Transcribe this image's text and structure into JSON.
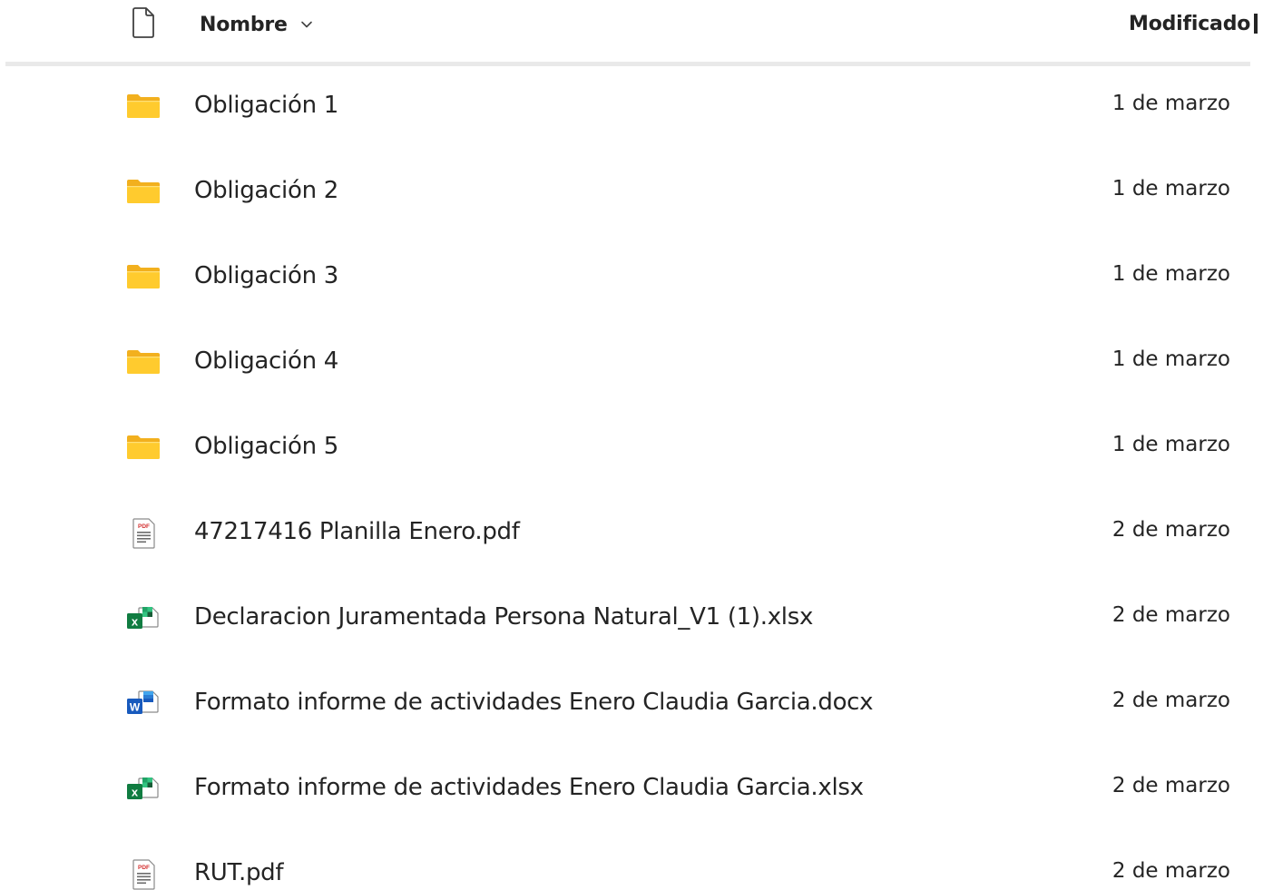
{
  "header": {
    "name_label": "Nombre",
    "modified_label": "Modificado",
    "file_icon": "file-icon",
    "sort_icon": "chevron-down-icon"
  },
  "colors": {
    "folder_front": "#FFCB2E",
    "folder_back": "#F2B01E",
    "excel_green": "#107C41",
    "word_blue": "#185ABD",
    "pdf_red": "#D32F2F",
    "divider": "#E9E9E9"
  },
  "items": [
    {
      "type": "folder",
      "icon": "folder-icon",
      "name": "Obligación 1",
      "modified": "1 de marzo"
    },
    {
      "type": "folder",
      "icon": "folder-icon",
      "name": "Obligación 2",
      "modified": "1 de marzo"
    },
    {
      "type": "folder",
      "icon": "folder-icon",
      "name": "Obligación 3",
      "modified": "1 de marzo"
    },
    {
      "type": "folder",
      "icon": "folder-icon",
      "name": "Obligación 4",
      "modified": "1 de marzo"
    },
    {
      "type": "folder",
      "icon": "folder-icon",
      "name": "Obligación 5",
      "modified": "1 de marzo"
    },
    {
      "type": "pdf",
      "icon": "pdf-file-icon",
      "name": "47217416 Planilla Enero.pdf",
      "modified": "2 de marzo"
    },
    {
      "type": "excel",
      "icon": "excel-file-icon",
      "name": "Declaracion Juramentada Persona Natural_V1 (1).xlsx",
      "modified": "2 de marzo"
    },
    {
      "type": "word",
      "icon": "word-file-icon",
      "name": "Formato informe de actividades Enero Claudia Garcia.docx",
      "modified": "2 de marzo"
    },
    {
      "type": "excel",
      "icon": "excel-file-icon",
      "name": "Formato informe de actividades Enero Claudia Garcia.xlsx",
      "modified": "2 de marzo"
    },
    {
      "type": "pdf",
      "icon": "pdf-file-icon",
      "name": "RUT.pdf",
      "modified": "2 de marzo"
    }
  ]
}
